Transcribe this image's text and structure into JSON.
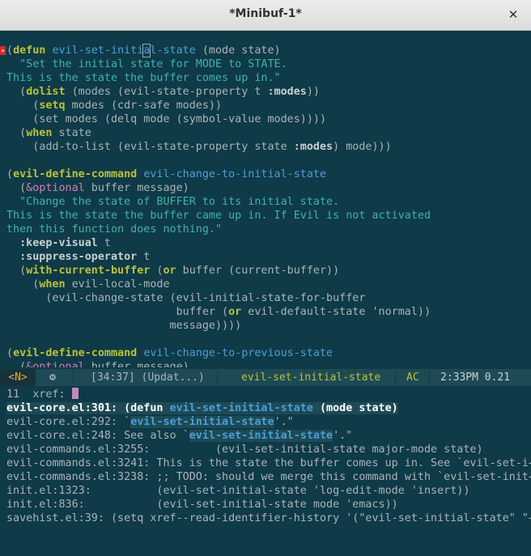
{
  "window": {
    "title": "*Minibuf-1*",
    "close_glyph": "✕"
  },
  "fringe_marker": "»",
  "modeline": {
    "state": "<N>",
    "icon_glyph": "⚙",
    "position": "[34:37] (Updat...)",
    "function": "evil-set-initial-state",
    "ac": "AC",
    "time_load": "2:33PM 0.21"
  },
  "minibuffer": {
    "prompt": "11  xref: "
  },
  "colors": {
    "background": "#0f3a47",
    "keyword": "#b9c23a",
    "function": "#4b9fd8",
    "string": "#3fb4a8",
    "optional": "#d27fb5"
  }
}
